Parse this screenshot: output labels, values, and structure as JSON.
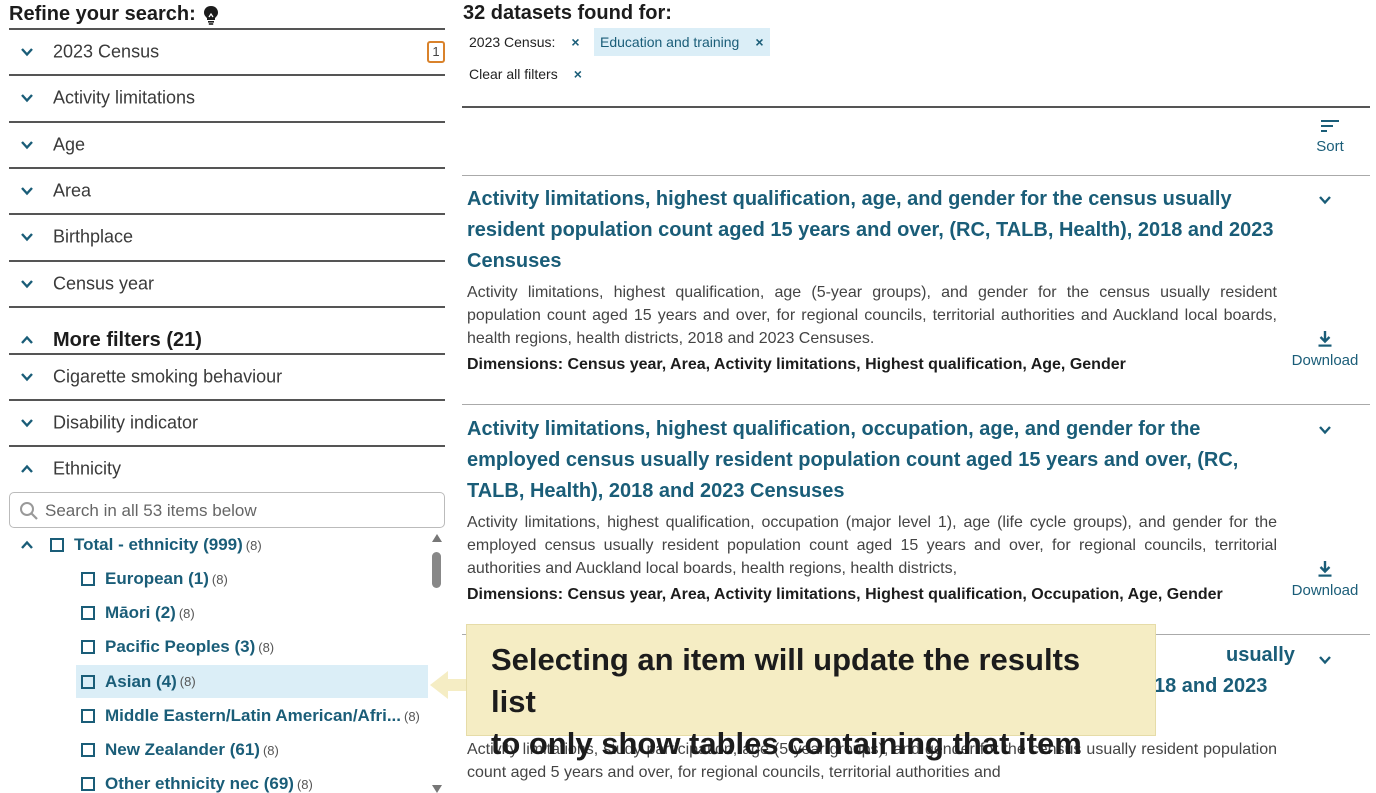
{
  "refine": {
    "title": "Refine your search:",
    "icon": "lightbulb-icon",
    "facets": [
      {
        "label": "2023 Census",
        "badge": "1"
      },
      {
        "label": "Activity limitations"
      },
      {
        "label": "Age"
      },
      {
        "label": "Area"
      },
      {
        "label": "Birthplace"
      },
      {
        "label": "Census year"
      }
    ],
    "more_filters_label": "More filters (21)",
    "more_facets": [
      {
        "label": "Cigarette smoking behaviour"
      },
      {
        "label": "Disability indicator"
      },
      {
        "label": "Ethnicity"
      }
    ],
    "search_placeholder": "Search in all 53 items below",
    "tree": [
      {
        "name": "Total - ethnicity (999)",
        "sub": "(8)"
      },
      {
        "name": "European (1)",
        "sub": "(8)"
      },
      {
        "name": "Māori (2)",
        "sub": "(8)"
      },
      {
        "name": "Pacific Peoples (3)",
        "sub": "(8)"
      },
      {
        "name": "Asian (4)",
        "sub": "(8)"
      },
      {
        "name": "Middle Eastern/Latin American/Afri...",
        "sub": "(8)"
      },
      {
        "name": "New Zealander (61)",
        "sub": "(8)"
      },
      {
        "name": "Other ethnicity nec (69)",
        "sub": "(8)"
      }
    ]
  },
  "results": {
    "found_label": "32 datasets found for:",
    "chips": {
      "census_label": "2023 Census:",
      "education_label": "Education and training",
      "clear_label": "Clear all filters",
      "remove_symbol": "×"
    },
    "sort_label": "Sort",
    "download_label": "Download",
    "dims_prefix": "Dimensions:",
    "items": [
      {
        "title": "Activity limitations, highest qualification, age, and gender for the census usually resident population count aged 15 years and over, (RC, TALB, Health), 2018 and 2023 Censuses",
        "desc": "Activity limitations, highest qualification, age (5-year groups), and gender for the census usually resident population count aged 15 years and over, for regional councils, territorial authorities and Auckland local boards, health regions, health districts, 2018 and 2023 Censuses.",
        "dims": "Census year, Area, Activity limitations, Highest qualification, Age, Gender"
      },
      {
        "title": "Activity limitations, highest qualification, occupation, age, and gender for the employed census usually resident population count aged 15 years and over, (RC, TALB, Health), 2018 and 2023 Censuses",
        "desc": "Activity limitations, highest qualification, occupation (major level 1), age (life cycle groups), and gender for the employed census usually resident population count aged 15 years and over, for regional councils, territorial authorities and Auckland local boards, health regions, health districts,",
        "dims": "Census year, Area, Activity limitations, Highest qualification, Occupation, Age, Gender"
      },
      {
        "title_line1": "usually",
        "title_line2": "18 and 2023",
        "desc": "Activity limitations, study participation, age (5-year groups), and gender for the census usually resident population count aged 5 years and over, for regional councils, territorial authorities and"
      }
    ]
  },
  "callout": {
    "line1": "Selecting an item will update the results list",
    "line2": "to only show tables containing that item"
  },
  "colors": {
    "accent": "#1a5d78",
    "highlight": "#dbeef7",
    "callout_bg": "#f5edc4",
    "badge_border": "#d9822b"
  }
}
